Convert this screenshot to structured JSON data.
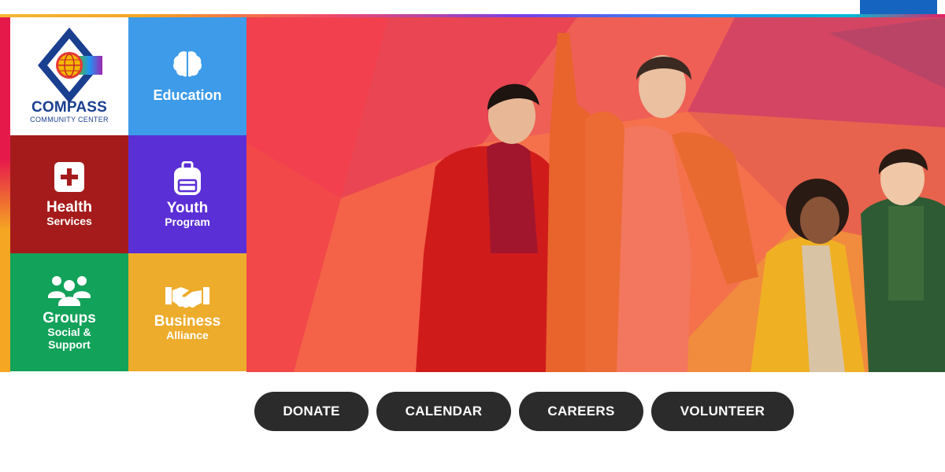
{
  "logo": {
    "name": "COMPASS",
    "subtitle": "COMMUNITY CENTER"
  },
  "tiles": {
    "education": {
      "label": "Education",
      "color": "#3d9be9",
      "icon": "brain-icon"
    },
    "health": {
      "line1": "Health",
      "line2": "Services",
      "color": "#a51b1b",
      "icon": "medical-cross-icon"
    },
    "youth": {
      "line1": "Youth",
      "line2": "Program",
      "color": "#5b2fd6",
      "icon": "backpack-icon"
    },
    "groups": {
      "line1": "Groups",
      "line2": "Social &",
      "line3": "Support",
      "color": "#12a25a",
      "icon": "people-group-icon"
    },
    "business": {
      "line1": "Business",
      "line2": "Alliance",
      "color": "#eeac2c",
      "icon": "handshake-icon"
    }
  },
  "buttons": {
    "donate": "DONATE",
    "calendar": "CALENDAR",
    "careers": "CAREERS",
    "volunteer": "VOLUNTEER",
    "color": "#2b2b2b"
  },
  "hero": {
    "image": "people-in-colorful-outfits-photo"
  }
}
